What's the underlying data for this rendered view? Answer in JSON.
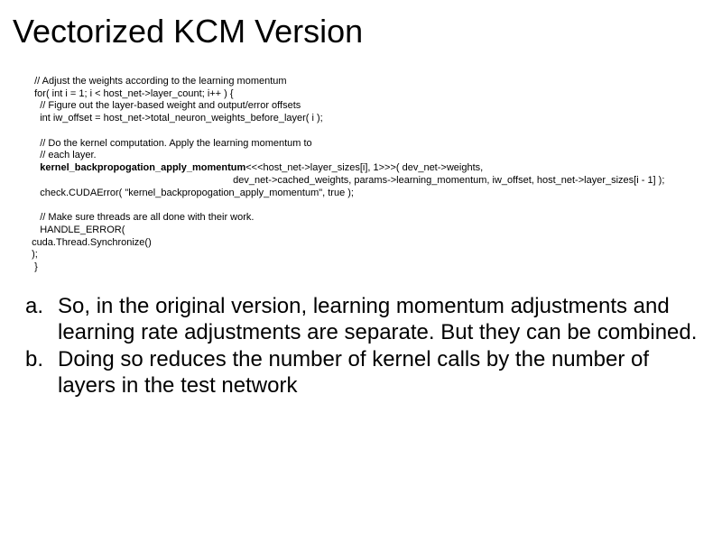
{
  "title": "Vectorized KCM Version",
  "code": {
    "l1": "  // Adjust the weights according to the learning momentum",
    "l2": "  for( int i = 1; i < host_net->layer_count; i++ ) {",
    "l3": "    // Figure out the layer-based weight and output/error offsets",
    "l4": "    int iw_offset = host_net->total_neuron_weights_before_layer( i );",
    "l5": "",
    "l6": "    // Do the kernel computation. Apply the learning momentum to",
    "l7": "    // each layer.",
    "l8a": "    kernel_backpropogation_apply_momentum",
    "l8b": "<<<host_net->layer_sizes[i], 1>>>( dev_net->weights,",
    "l9": "                                                                          dev_net->cached_weights, params->learning_momentum, iw_offset, host_net->layer_sizes[i - 1] );",
    "l10": "    check.CUDAError( \"kernel_backpropogation_apply_momentum\", true );",
    "l11": "",
    "l12": "    // Make sure threads are all done with their work.",
    "l13": "    HANDLE_ERROR(",
    "l14": " cuda.Thread.Synchronize()",
    "l15": " );",
    "l16": "  }"
  },
  "notes": {
    "a_marker": "a.",
    "a_text": "So, in the original version, learning momentum adjustments and learning rate adjustments are separate.  But they can be combined.",
    "b_marker": "b.",
    "b_text": "Doing so reduces the number of kernel calls by the number of layers in the test network"
  }
}
